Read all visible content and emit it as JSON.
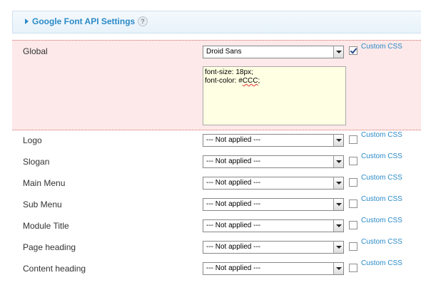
{
  "header": {
    "title": "Google Font API Settings",
    "help_icon": "help-icon",
    "help_glyph": "?"
  },
  "custom_css_label": "Custom CSS",
  "global": {
    "label": "Global",
    "font_value": "Droid Sans",
    "custom_css_checked": true,
    "css_lines": [
      "font-size: 18px;",
      "font-color: #"
    ],
    "css_misspelled": "CCC",
    "css_trailing": ";"
  },
  "rows": [
    {
      "label": "Logo",
      "value": "--- Not applied ---",
      "checked": false
    },
    {
      "label": "Slogan",
      "value": "--- Not applied ---",
      "checked": false
    },
    {
      "label": "Main Menu",
      "value": "--- Not applied ---",
      "checked": false
    },
    {
      "label": "Sub Menu",
      "value": "--- Not applied ---",
      "checked": false
    },
    {
      "label": "Module Title",
      "value": "--- Not applied ---",
      "checked": false
    },
    {
      "label": "Page heading",
      "value": "--- Not applied ---",
      "checked": false
    },
    {
      "label": "Content heading",
      "value": "--- Not applied ---",
      "checked": false
    }
  ]
}
